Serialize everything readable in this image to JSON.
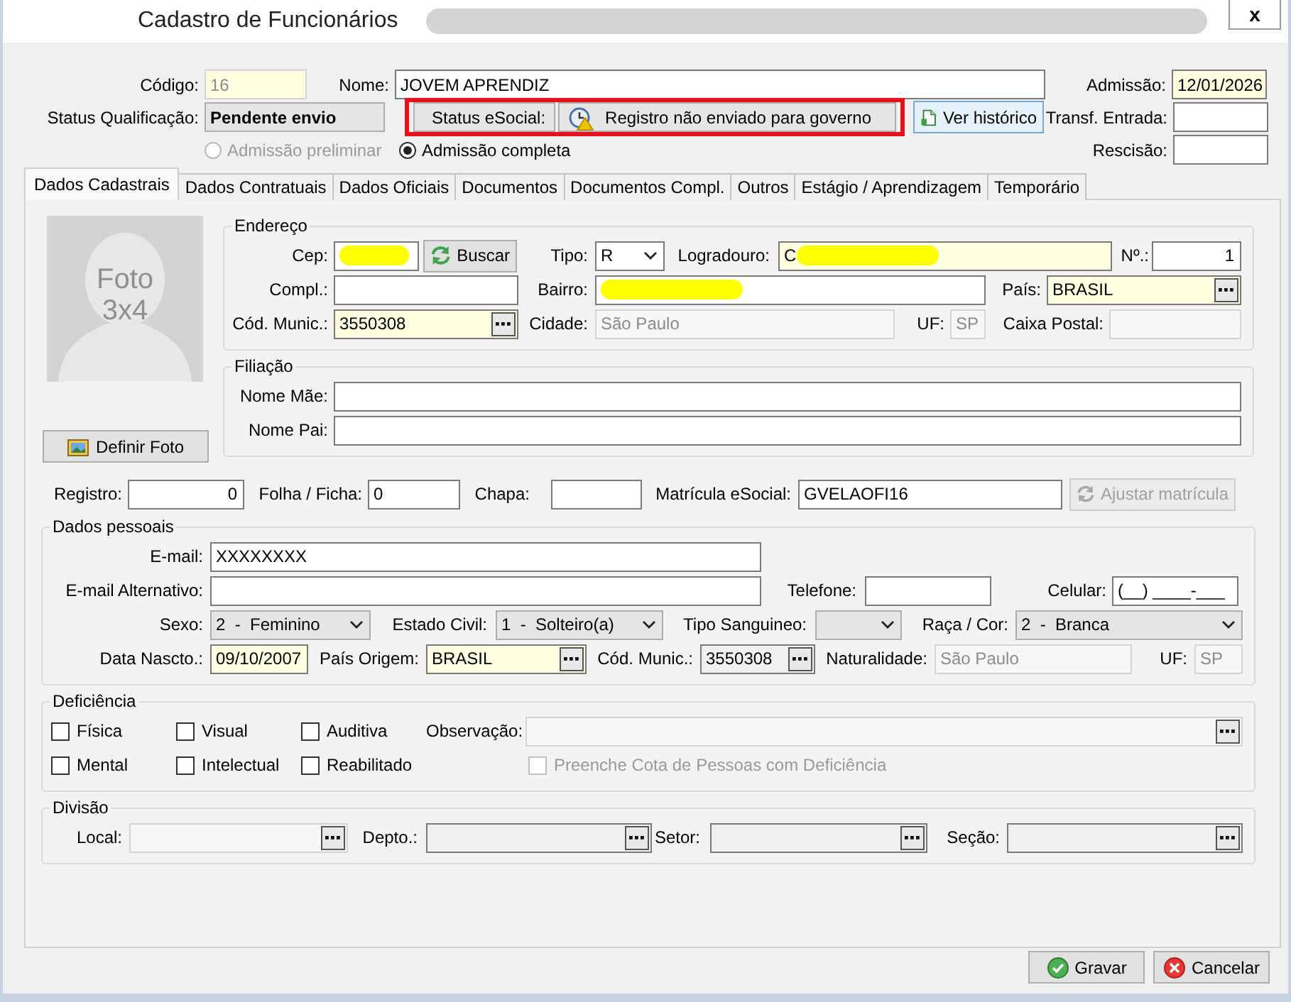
{
  "window": {
    "title": "Cadastro de Funcionários",
    "close_label": "x"
  },
  "header": {
    "codigo": {
      "label": "Código:",
      "value": "16",
      "kind": "text",
      "disabled": true,
      "required": true
    },
    "nome": {
      "label": "Nome:",
      "value": "JOVEM APRENDIZ",
      "kind": "text",
      "disabled": false,
      "required": false
    },
    "admissao": {
      "label": "Admissão:",
      "value": "12/01/2026",
      "kind": "text",
      "disabled": false,
      "required": true
    },
    "status_qualificacao": {
      "label": "Status Qualificação:",
      "value": "Pendente envio"
    },
    "status_esocial": {
      "label": "Status eSocial:",
      "value": "Registro não enviado para governo",
      "highlighted": true
    },
    "ver_historico": {
      "label": "Ver histórico",
      "disabled": false
    },
    "transf_entrada": {
      "label": "Transf. Entrada:",
      "kind": "text",
      "disabled": false,
      "required": false
    },
    "admissao_tipo": [
      {
        "label": "Admissão preliminar",
        "selected": false,
        "disabled": true
      },
      {
        "label": "Admissão completa",
        "selected": true,
        "disabled": false
      }
    ],
    "rescisao": {
      "label": "Rescisão:",
      "kind": "text",
      "disabled": false,
      "required": false
    }
  },
  "tabs": [
    {
      "label": "Dados Cadastrais",
      "selected": true
    },
    {
      "label": "Dados Contratuais",
      "selected": false
    },
    {
      "label": "Dados Oficiais",
      "selected": false
    },
    {
      "label": "Documentos",
      "selected": false
    },
    {
      "label": "Documentos Compl.",
      "selected": false
    },
    {
      "label": "Outros",
      "selected": false
    },
    {
      "label": "Estágio / Aprendizagem",
      "selected": false
    },
    {
      "label": "Temporário",
      "selected": false
    }
  ],
  "photo": {
    "caption": "Foto 3x4",
    "button": {
      "label": "Definir Foto",
      "disabled": false
    }
  },
  "endereco": {
    "title": "Endereço",
    "cep": {
      "label": "Cep:",
      "kind": "text",
      "disabled": false,
      "required": false,
      "redacted": true
    },
    "buscar": {
      "label": "Buscar",
      "disabled": false
    },
    "tipo": {
      "label": "Tipo:",
      "value": "R",
      "kind": "combo",
      "disabled": false,
      "required": false
    },
    "logradouro": {
      "label": "Logradouro:",
      "value": "C",
      "kind": "text",
      "disabled": false,
      "required": true,
      "redacted": true
    },
    "numero": {
      "label": "Nº.:",
      "value": "1",
      "kind": "text",
      "disabled": false,
      "required": false
    },
    "complemento": {
      "label": "Compl.:",
      "kind": "text",
      "disabled": false,
      "required": false
    },
    "bairro": {
      "label": "Bairro:",
      "kind": "text",
      "disabled": false,
      "required": false,
      "redacted": true
    },
    "pais": {
      "label": "País:",
      "value": "BRASIL",
      "kind": "lookup",
      "disabled": false,
      "required": true
    },
    "cod_munic": {
      "label": "Cód. Munic.:",
      "value": "3550308",
      "kind": "lookup",
      "disabled": false,
      "required": true
    },
    "cidade": {
      "label": "Cidade:",
      "value": "São Paulo",
      "kind": "text",
      "disabled": true,
      "required": false
    },
    "uf": {
      "label": "UF:",
      "value": "SP",
      "kind": "text",
      "disabled": true,
      "required": false
    },
    "caixa_postal": {
      "label": "Caixa Postal:",
      "kind": "text",
      "disabled": true,
      "required": false
    }
  },
  "filiacao": {
    "title": "Filiação",
    "nome_mae": {
      "label": "Nome Mãe:",
      "kind": "text",
      "disabled": false,
      "required": false
    },
    "nome_pai": {
      "label": "Nome Pai:",
      "kind": "text",
      "disabled": false,
      "required": false
    }
  },
  "registro": {
    "registro": {
      "label": "Registro:",
      "value": "0",
      "kind": "text",
      "disabled": false,
      "required": false
    },
    "folha": {
      "label": "Folha / Ficha:",
      "value": "0",
      "kind": "text",
      "disabled": false,
      "required": false
    },
    "chapa": {
      "label": "Chapa:",
      "kind": "text",
      "disabled": false,
      "required": false
    },
    "matricula": {
      "label": "Matrícula eSocial:",
      "value": "GVELAOFI16",
      "kind": "text",
      "disabled": false,
      "required": false
    },
    "ajustar": {
      "label": "Ajustar matrícula",
      "disabled": true
    }
  },
  "dados_pessoais": {
    "title": "Dados pessoais",
    "email": {
      "label": "E-mail:",
      "value": "XXXXXXXX",
      "kind": "text",
      "disabled": false,
      "required": false
    },
    "email_alt": {
      "label": "E-mail Alternativo:",
      "kind": "text",
      "disabled": false,
      "required": false
    },
    "telefone": {
      "label": "Telefone:",
      "kind": "text",
      "disabled": false,
      "required": false
    },
    "celular": {
      "label": "Celular:",
      "value": "(__) ____-___",
      "kind": "text",
      "disabled": false,
      "required": false
    },
    "sexo": {
      "label": "Sexo:",
      "value": "2  -  Feminino",
      "kind": "list",
      "disabled": false,
      "required": false
    },
    "estado_civil": {
      "label": "Estado Civil:",
      "value": "1  -  Solteiro(a)",
      "kind": "list",
      "disabled": false,
      "required": false
    },
    "tipo_sanguineo": {
      "label": "Tipo Sanguineo:",
      "kind": "list",
      "disabled": false,
      "required": false
    },
    "raca": {
      "label": "Raça / Cor:",
      "value": "2  -  Branca",
      "kind": "list",
      "disabled": false,
      "required": false
    },
    "data_nascto": {
      "label": "Data Nascto.:",
      "value": "09/10/2007",
      "kind": "text",
      "disabled": false,
      "required": true
    },
    "pais_origem": {
      "label": "País Origem:",
      "value": "BRASIL",
      "kind": "lookup",
      "disabled": false,
      "required": true
    },
    "cod_munic": {
      "label": "Cód. Munic.:",
      "value": "3550308",
      "kind": "lookup",
      "disabled": false,
      "required": false,
      "readonly": true
    },
    "naturalidade": {
      "label": "Naturalidade:",
      "value": "São Paulo",
      "kind": "text",
      "disabled": true,
      "required": false
    },
    "uf": {
      "label": "UF:",
      "value": "SP",
      "kind": "text",
      "disabled": true,
      "required": false
    }
  },
  "deficiencia": {
    "title": "Deficiência",
    "options": [
      {
        "label": "Física",
        "checked": false
      },
      {
        "label": "Visual",
        "checked": false
      },
      {
        "label": "Auditiva",
        "checked": false
      },
      {
        "label": "Mental",
        "checked": false
      },
      {
        "label": "Intelectual",
        "checked": false
      },
      {
        "label": "Reabilitado",
        "checked": false
      }
    ],
    "observacao": {
      "label": "Observação:",
      "kind": "lookup",
      "disabled": true,
      "required": false
    },
    "cota": {
      "label": "Preenche Cota de Pessoas com Deficiência",
      "checked": false,
      "disabled": true
    }
  },
  "divisao": {
    "title": "Divisão",
    "local": {
      "label": "Local:",
      "kind": "lookup",
      "disabled": true,
      "required": false
    },
    "depto": {
      "label": "Depto.:",
      "kind": "lookup",
      "disabled": false,
      "required": false,
      "readonly": true
    },
    "setor": {
      "label": "Setor:",
      "kind": "lookup",
      "disabled": false,
      "required": false,
      "readonly": true
    },
    "secao": {
      "label": "Seção:",
      "kind": "lookup",
      "disabled": false,
      "required": false,
      "readonly": true
    }
  },
  "actions": [
    {
      "label": "Gravar",
      "kind": "save",
      "disabled": false
    },
    {
      "label": "Cancelar",
      "kind": "cancel",
      "disabled": false
    }
  ]
}
